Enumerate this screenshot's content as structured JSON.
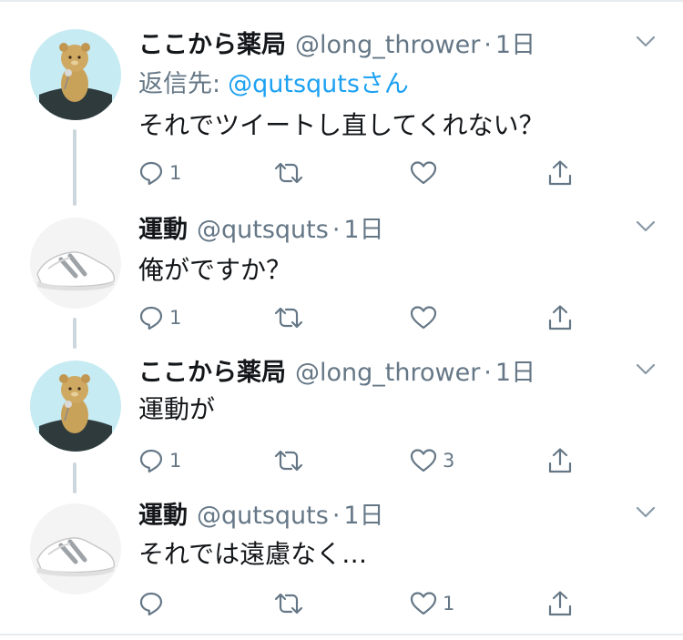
{
  "tweets": [
    {
      "name": "ここから薬局",
      "handle": "@long_thrower",
      "dot": "·",
      "time": "1日",
      "avatar": "bear-avatar",
      "reply_prefix": "返信先:",
      "reply_mention": "@qutsqutsさん",
      "text": "それでツイートし直してくれない？",
      "reply_count": "1",
      "retweet_count": "",
      "like_count": ""
    },
    {
      "name": "運動",
      "handle": "@qutsquts",
      "dot": "·",
      "time": "1日",
      "avatar": "shoe-avatar",
      "text": "俺がですか？",
      "reply_count": "1",
      "retweet_count": "",
      "like_count": ""
    },
    {
      "name": "ここから薬局",
      "handle": "@long_thrower",
      "dot": "·",
      "time": "1日",
      "avatar": "bear-avatar",
      "text": "運動が",
      "reply_count": "1",
      "retweet_count": "",
      "like_count": "3"
    },
    {
      "name": "運動",
      "handle": "@qutsquts",
      "dot": "·",
      "time": "1日",
      "avatar": "shoe-avatar",
      "text": "それでは遠慮なく…",
      "reply_count": "",
      "retweet_count": "",
      "like_count": "1"
    }
  ],
  "colors": {
    "text": "#14171a",
    "muted": "#657786",
    "link": "#1da1f2",
    "thread_line": "#ccd6dd",
    "icon": "#657786"
  },
  "icons": [
    "reply-icon",
    "retweet-icon",
    "like-icon",
    "share-icon",
    "chevron-down-icon"
  ]
}
